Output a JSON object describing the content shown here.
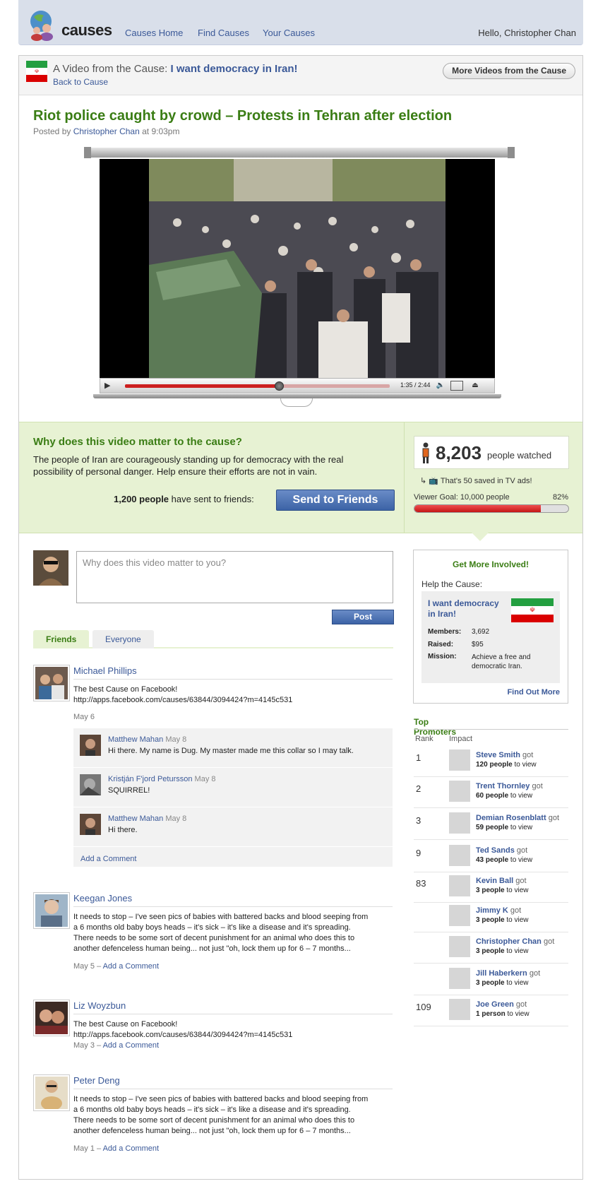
{
  "header": {
    "logo_text": "causes",
    "nav": [
      "Causes Home",
      "Find Causes",
      "Your Causes"
    ],
    "greeting": "Hello, Christopher Chan"
  },
  "cause_bar": {
    "prefix": "A Video from the Cause: ",
    "cause_name": "I want democracy in Iran!",
    "back_label": "Back to Cause",
    "more_button": "More Videos from the Cause"
  },
  "video": {
    "title": "Riot police caught by crowd – Protests in Tehran after election",
    "posted_prefix": "Posted by ",
    "author": "Christopher Chan",
    "posted_suffix": " at 9:03pm",
    "time_display": "1:35 / 2:44",
    "progress": 0.58
  },
  "why": {
    "title": "Why does this video matter to the cause?",
    "text": "The people of Iran are courageously standing up for democracy with the real possibility of personal danger. Help ensure their efforts are not in vain.",
    "sent_count": "1,200 people",
    "sent_suffix": " have sent to friends:",
    "send_button": "Send to Friends"
  },
  "stats": {
    "watched_count": "8,203",
    "watched_label": "people watched",
    "saved_text": "That's 50 saved in TV ads!",
    "goal_label": "Viewer Goal: 10,000 people",
    "goal_percent": "82%",
    "goal_fraction": 0.82
  },
  "composer": {
    "placeholder": "Why does this video matter to you?",
    "post_button": "Post",
    "tabs": [
      "Friends",
      "Everyone"
    ]
  },
  "feed": {
    "add_comment": "Add a Comment",
    "posts": [
      {
        "name": "Michael Phillips",
        "text": "The best Cause on Facebook!\nhttp://apps.facebook.com/causes/63844/3094424?m=4145c531",
        "date": "May 6",
        "replies": [
          {
            "name": "Matthew Mahan",
            "date": "May 8",
            "text": "Hi there. My name is Dug. My master made me this collar so I may talk."
          },
          {
            "name": "Kristján F'jord Petursson",
            "date": "May 8",
            "text": "SQUIRREL!"
          },
          {
            "name": "Matthew Mahan",
            "date": "May 8",
            "text": "Hi there."
          }
        ]
      },
      {
        "name": "Keegan Jones",
        "text": "It needs to stop – I've seen pics of babies with battered backs and blood seeping from a 6 months old baby boys heads – it's sick – it's like a disease and it's spreading. There needs to be some sort of decent punishment for an animal who does this to another defenceless human being... not just \"oh, lock them up for 6 – 7 months...",
        "date": "May 5 – "
      },
      {
        "name": "Liz Woyzbun",
        "text": "The best Cause on Facebook!\nhttp://apps.facebook.com/causes/63844/3094424?m=4145c531",
        "date": "May 3 – "
      },
      {
        "name": "Peter Deng",
        "text": "It needs to stop – I've seen pics of babies with battered backs and blood seeping from a 6 months old baby boys heads – it's sick – it's like a disease and it's spreading. There needs to be some sort of decent punishment for an animal who does this to another defenceless human being... not just \"oh, lock them up for 6 – 7 months...",
        "date": "May 1 – "
      }
    ]
  },
  "involved": {
    "title": "Get More Involved!",
    "help_label": "Help the Cause:",
    "cause_name": "I want democracy in Iran!",
    "members_label": "Members:",
    "members": "3,692",
    "raised_label": "Raised:",
    "raised": "$95",
    "mission_label": "Mission:",
    "mission": "Achieve a free and democratic Iran.",
    "find_more": "Find Out More"
  },
  "promoters": {
    "title": "Top Promoters",
    "col_rank": "Rank",
    "col_impact": "Impact",
    "got_word": "got",
    "rows": [
      {
        "rank": "1",
        "name": "Steve Smith",
        "count": "120 people",
        "suffix": " to view"
      },
      {
        "rank": "2",
        "name": "Trent Thornley",
        "count": "60 people",
        "suffix": " to view"
      },
      {
        "rank": "3",
        "name": "Demian Rosenblatt",
        "count": "59 people",
        "suffix": " to view"
      },
      {
        "rank": "9",
        "name": "Ted Sands",
        "count": "43 people",
        "suffix": " to view"
      },
      {
        "rank": "83",
        "name": "Kevin Ball",
        "count": "3 people",
        "suffix": " to view"
      },
      {
        "rank": "",
        "name": "Jimmy K",
        "count": "3 people",
        "suffix": " to view"
      },
      {
        "rank": "",
        "name": "Christopher Chan",
        "count": "3 people",
        "suffix": " to view"
      },
      {
        "rank": "",
        "name": "Jill Haberkern",
        "count": "3 people",
        "suffix": " to view"
      },
      {
        "rank": "109",
        "name": "Joe Green",
        "count": "1 person",
        "suffix": " to view"
      }
    ]
  },
  "colors": {
    "accent_green": "#3a7d14",
    "link_blue": "#3b5998",
    "panel_green": "#e7f2d3",
    "bar_red": "#cc1f1f"
  }
}
